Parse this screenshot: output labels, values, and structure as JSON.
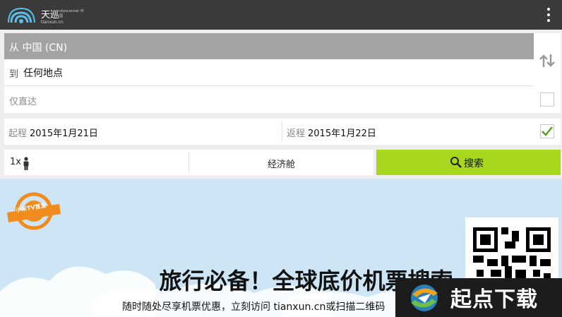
{
  "app": {
    "logo_cn": "天巡",
    "logo_small": "skyscanner 中国",
    "logo_domain": "tianxun.cn",
    "menu_icon": "overflow-menu-icon"
  },
  "search": {
    "from_text": "从 中国 (CN)",
    "to_prefix": "到",
    "to_value": "任何地点",
    "direct_label": "仅直达",
    "direct_checked": false,
    "swap_icon": "swap-arrows-icon"
  },
  "dates": {
    "depart_label": "起程",
    "depart_value": "2015年1月21日",
    "return_label": "返程",
    "return_value": "2015年1月22日",
    "return_checked": true
  },
  "passengers": {
    "count": "1x",
    "icon": "person-icon",
    "cabin": "经济舱"
  },
  "search_button": {
    "label": "搜索",
    "icon": "search-icon",
    "color": "#a8d81e"
  },
  "banner": {
    "badge_text": "小米TV首发",
    "headline": "旅行必备！全球底价机票搜索",
    "subline": "随时随处尽享机票优惠，立刻访问 tianxun.cn或扫描二维码"
  },
  "watermark": {
    "text": "起点下载"
  },
  "colors": {
    "topbar": "#3a3a3a",
    "from_row": "#a3a3a3",
    "accent_green": "#a8d81e",
    "banner_bg": "#cde5f4",
    "badge_orange": "#f08c1e"
  }
}
